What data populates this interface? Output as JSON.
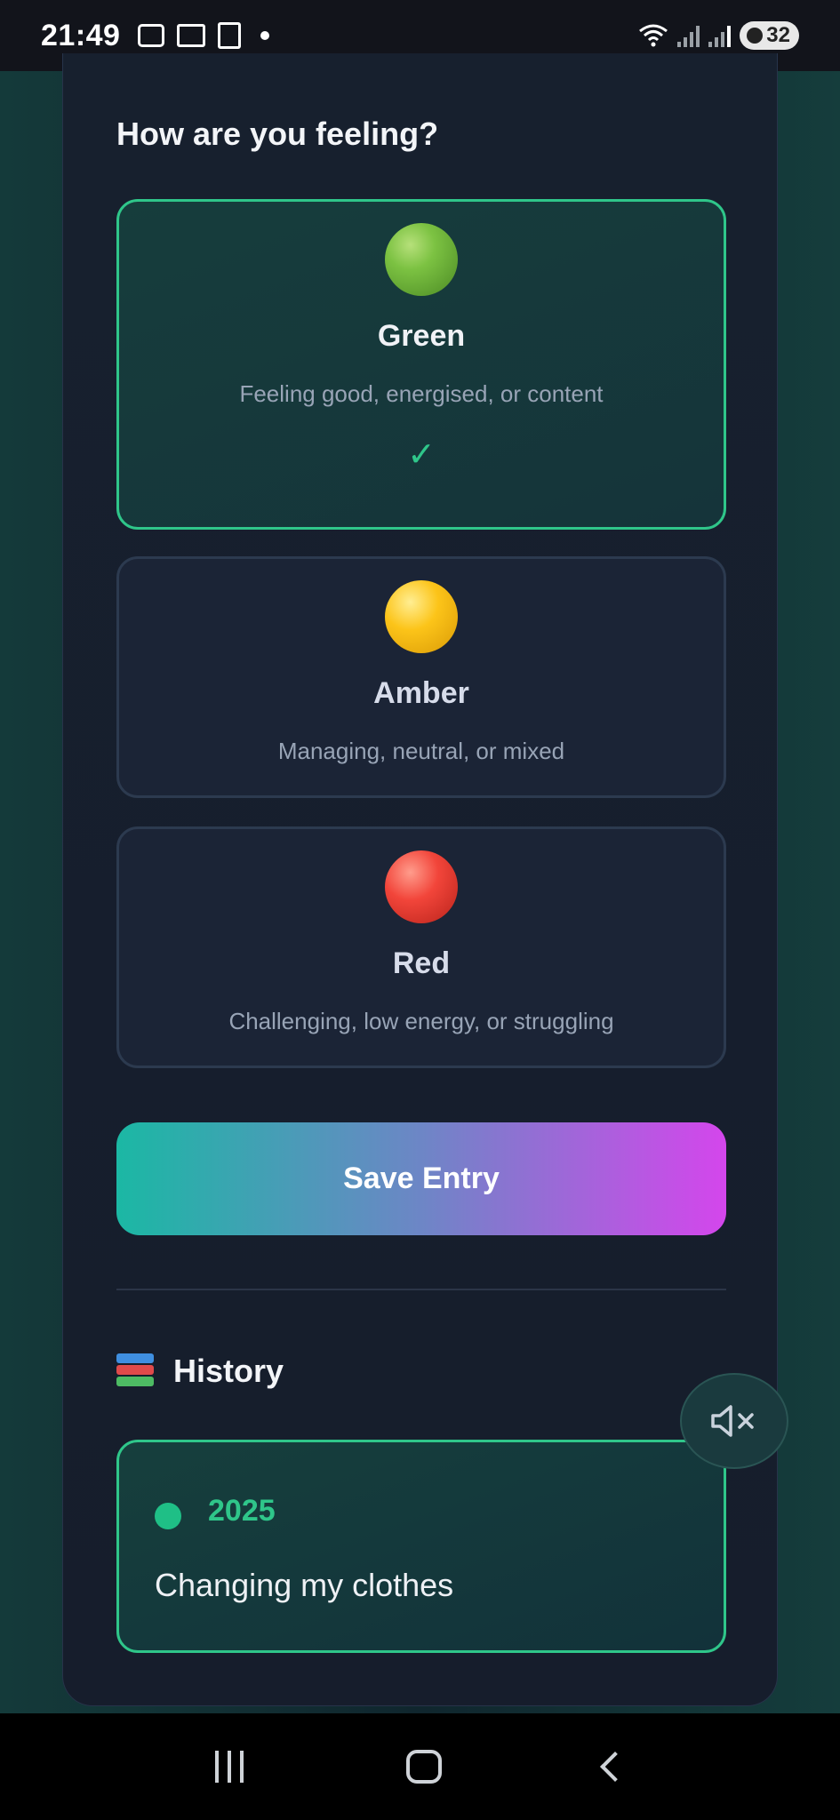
{
  "status_bar": {
    "time": "21:49",
    "battery": "32"
  },
  "mood_section": {
    "title": "How are you feeling?",
    "options": [
      {
        "label": "Green",
        "description": "Feeling good, energised, or content",
        "selected": true,
        "color": "#2fc68a"
      },
      {
        "label": "Amber",
        "description": "Managing, neutral, or mixed",
        "selected": false,
        "color": "#fcc419"
      },
      {
        "label": "Red",
        "description": "Challenging, low energy, or struggling",
        "selected": false,
        "color": "#f2453a"
      }
    ],
    "check_mark": "✓"
  },
  "save_button": {
    "label": "Save Entry"
  },
  "history": {
    "title": "History",
    "entries": [
      {
        "year": "2025",
        "text": "Changing my clothes",
        "status_color": "#1fbf86"
      }
    ]
  },
  "colors": {
    "accent": "#2fc68a",
    "card_bg": "#17202e",
    "gradient_start": "#1bb8a4",
    "gradient_end": "#d446ec"
  },
  "icons": {
    "mute": "speaker-muted-icon",
    "books": "books-icon",
    "check": "check-icon"
  }
}
